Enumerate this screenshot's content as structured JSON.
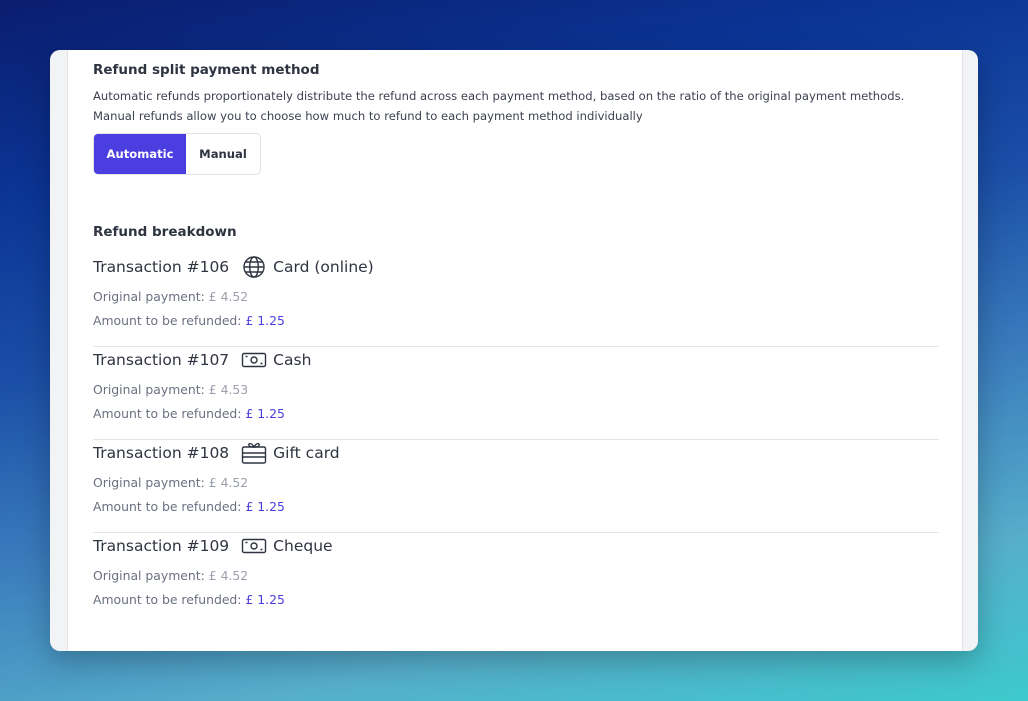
{
  "split": {
    "title": "Refund split payment method",
    "description": "Automatic refunds proportionately distribute the refund across each payment method, based on the ratio of the original payment methods. Manual refunds allow you to choose how much to refund to each payment method individually",
    "options": [
      "Automatic",
      "Manual"
    ],
    "selected": "Automatic"
  },
  "breakdown": {
    "title": "Refund breakdown",
    "original_label": "Original payment:",
    "refund_label": "Amount to be refunded:",
    "transactions": [
      {
        "title": "Transaction #106",
        "method": "Card (online)",
        "icon": "globe-icon",
        "original": "£ 4.52",
        "refund": "£ 1.25"
      },
      {
        "title": "Transaction #107",
        "method": "Cash",
        "icon": "cash-icon",
        "original": "£ 4.53",
        "refund": "£ 1.25"
      },
      {
        "title": "Transaction #108",
        "method": "Gift card",
        "icon": "gift-card-icon",
        "original": "£ 4.52",
        "refund": "£ 1.25"
      },
      {
        "title": "Transaction #109",
        "method": "Cheque",
        "icon": "cheque-icon",
        "original": "£ 4.52",
        "refund": "£ 1.25"
      }
    ]
  },
  "colors": {
    "accent": "#4b3ee0",
    "text": "#2f3441",
    "muted": "#9a9fab"
  }
}
